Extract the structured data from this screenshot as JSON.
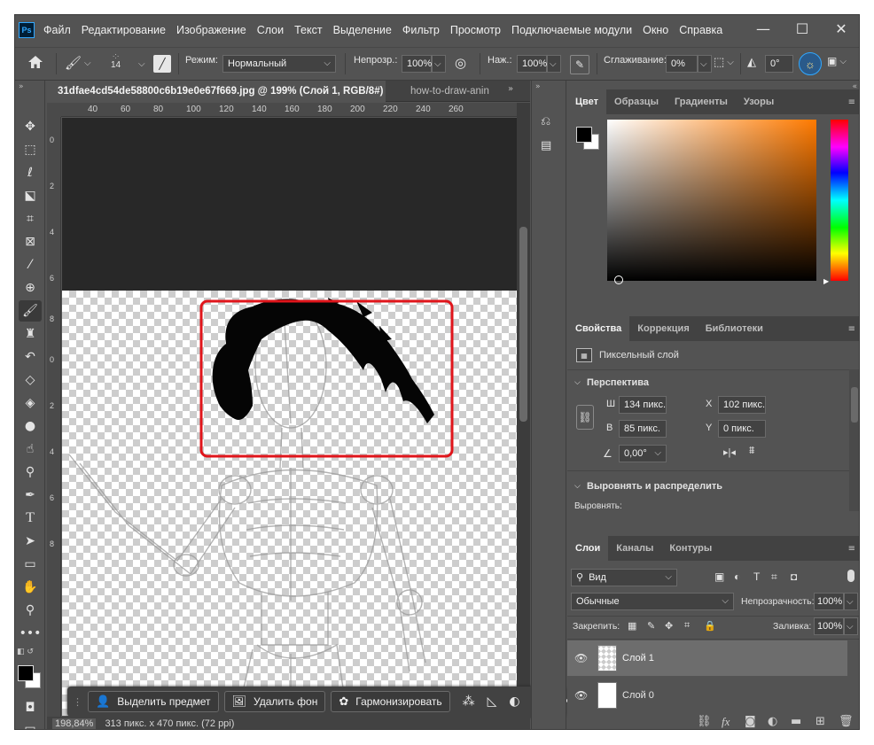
{
  "app": {
    "logo": "Ps"
  },
  "menu": [
    "Файл",
    "Редактирование",
    "Изображение",
    "Слои",
    "Текст",
    "Выделение",
    "Фильтр",
    "Просмотр",
    "Подключаемые модули",
    "Окно",
    "Справка"
  ],
  "window_controls": {
    "minimize": "—",
    "maximize": "☐",
    "close": "✕"
  },
  "options": {
    "brush_size": "14",
    "mode_label": "Режим:",
    "mode_value": "Нормальный",
    "opacity_label": "Непрозр.:",
    "opacity_value": "100%",
    "pressure_label": "Наж.:",
    "pressure_value": "100%",
    "smoothing_label": "Сглаживание:",
    "smoothing_value": "0%",
    "angle_value": "0°"
  },
  "document": {
    "active_tab": "31dfae4cd54de58800c6b19e0e67f669.jpg @ 199% (Слой 1, RGB/8#) *",
    "close_glyph": "×",
    "inactive_tab": "how-to-draw-anin"
  },
  "ruler": {
    "h_ticks": [
      "40",
      "60",
      "80",
      "100",
      "120",
      "140",
      "160",
      "180",
      "200",
      "220",
      "240",
      "260"
    ],
    "v_ticks": [
      "0",
      "2",
      "4",
      "6",
      "8",
      "0",
      "2",
      "4",
      "6",
      "8"
    ]
  },
  "contextbar": {
    "select_subject": "Выделить предмет",
    "remove_bg": "Удалить фон",
    "harmonize": "Гармонизировать",
    "more": "•••"
  },
  "status": {
    "zoom": "198,84%",
    "size": "313 пикс. x 470 пикс. (72 ppi)"
  },
  "color_panel": {
    "tabs": [
      "Цвет",
      "Образцы",
      "Градиенты",
      "Узоры"
    ],
    "fg": "#000000",
    "bg": "#ffffff",
    "hue": "#ff7a00"
  },
  "properties_panel": {
    "tabs": [
      "Свойства",
      "Коррекция",
      "Библиотеки"
    ],
    "layer_type": "Пиксельный слой",
    "section_transform": "Перспектива",
    "w_label": "Ш",
    "w_value": "134 пикс.",
    "x_label": "X",
    "x_value": "102 пикс.",
    "h_label": "В",
    "h_value": "85 пикс.",
    "y_label": "Y",
    "y_value": "0 пикс.",
    "angle_value": "0,00°",
    "section_align": "Выровнять и распределить",
    "align_label": "Выровнять:"
  },
  "layers_panel": {
    "tabs": [
      "Слои",
      "Каналы",
      "Контуры"
    ],
    "filter_value": "Вид",
    "blend_mode": "Обычные",
    "opacity_label": "Непрозрачность:",
    "opacity_value": "100%",
    "lock_label": "Закрепить:",
    "fill_label": "Заливка:",
    "fill_value": "100%",
    "layers": [
      {
        "name": "Слой 1",
        "selected": true
      },
      {
        "name": "Слой 0",
        "selected": false
      }
    ]
  },
  "accent": "#31a8ff",
  "highlight_color": "#e0151b"
}
